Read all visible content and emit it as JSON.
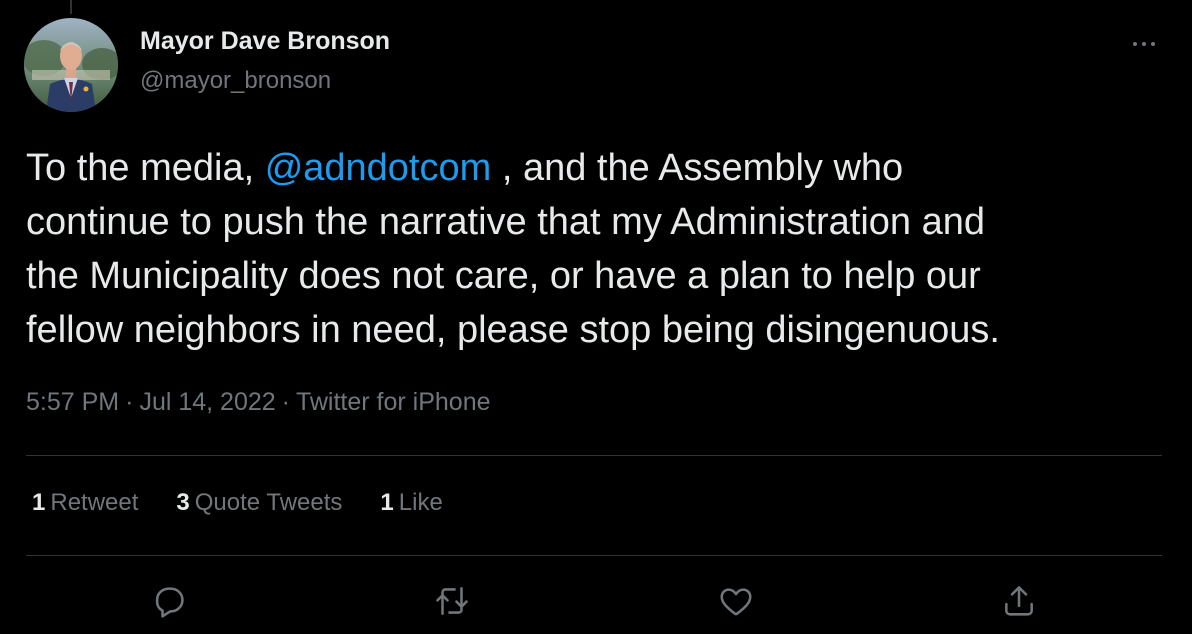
{
  "colors": {
    "background": "#000000",
    "text": "#e7e9ea",
    "muted": "#71767b",
    "accent": "#1d9bf0",
    "divider": "#2f3336"
  },
  "author": {
    "display_name": "Mayor Dave Bronson",
    "handle": "@mayor_bronson"
  },
  "tweet": {
    "line1_before": "To the media, ",
    "mention": "@adndotcom",
    "line1_after": " , and the Assembly who",
    "line2": "continue to push the narrative that my Administration and",
    "line3": "the Municipality does not care, or have a plan to help our",
    "line4": "fellow neighbors in need, please stop being disingenuous."
  },
  "meta": {
    "time": "5:57 PM",
    "separator": "·",
    "date": "Jul 14, 2022",
    "source": "Twitter for iPhone"
  },
  "stats": {
    "retweets_count": "1",
    "retweets_label": "Retweet",
    "quotes_count": "3",
    "quotes_label": "Quote Tweets",
    "likes_count": "1",
    "likes_label": "Like"
  },
  "icons": {
    "more": "more-horizontal-icon",
    "reply": "reply-icon",
    "retweet": "retweet-icon",
    "like": "heart-icon",
    "share": "share-icon"
  }
}
